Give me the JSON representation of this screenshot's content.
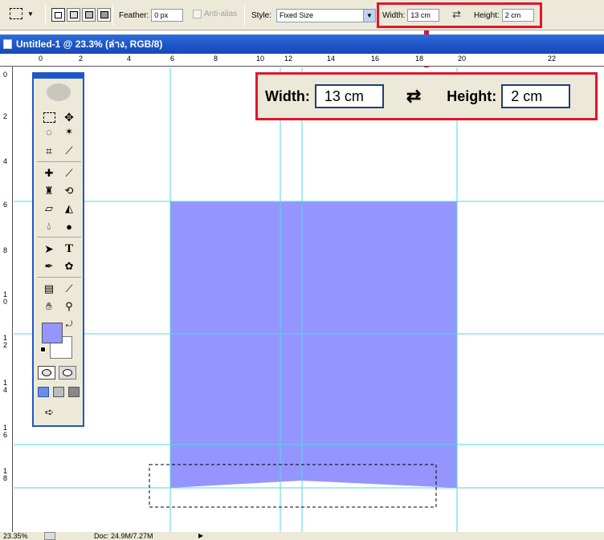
{
  "options_bar": {
    "feather_label": "Feather:",
    "feather_value": "0 px",
    "antialias_label": "Anti-alias",
    "style_label": "Style:",
    "style_value": "Fixed Size",
    "width_label": "Width:",
    "width_value": "13 cm",
    "height_label": "Height:",
    "height_value": "2 cm"
  },
  "document": {
    "title": "Untitled-1 @ 23.3% (ล่าง, RGB/8)"
  },
  "rulers": {
    "horizontal": [
      "0",
      "2",
      "4",
      "6",
      "8",
      "10",
      "12",
      "14",
      "16",
      "18",
      "20",
      "22"
    ],
    "vertical": [
      "0",
      "2",
      "4",
      "6",
      "8",
      "10",
      "12",
      "14",
      "16",
      "18"
    ]
  },
  "status_bar": {
    "zoom": "23.35%",
    "doc_info": "Doc: 24.9M/7.27M"
  },
  "callout": {
    "width_label": "Width:",
    "width_value": "13 cm",
    "height_label": "Height:",
    "height_value": "2 cm"
  },
  "colors": {
    "shape_fill": "#9595ff",
    "guide": "#4dd9e6",
    "highlight_red": "#e0162b",
    "foreground": "#9595ff",
    "background": "#ffffff"
  }
}
